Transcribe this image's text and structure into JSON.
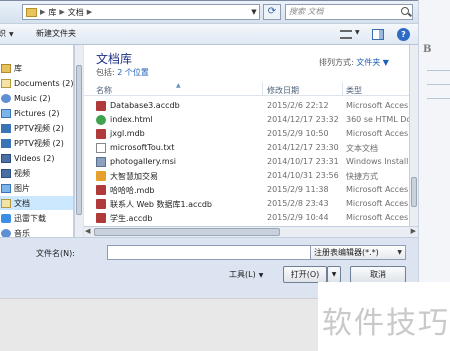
{
  "address_bar": {
    "segments": [
      "库",
      "文档"
    ]
  },
  "search": {
    "placeholder": "搜索 文档"
  },
  "toolbar": {
    "organize": "组织",
    "new_folder": "新建文件夹"
  },
  "nav": {
    "items": [
      {
        "label": "库",
        "icon": "library-icon"
      },
      {
        "label": "Documents (2)",
        "icon": "documents-icon"
      },
      {
        "label": "Music (2)",
        "icon": "music-icon"
      },
      {
        "label": "Pictures (2)",
        "icon": "pictures-icon"
      },
      {
        "label": "PPTV视频 (2)",
        "icon": "pptv-icon"
      },
      {
        "label": "PPTV视频 (2)",
        "icon": "pptv-icon"
      },
      {
        "label": "Videos (2)",
        "icon": "videos-icon"
      },
      {
        "label": "视频",
        "icon": "video-icon"
      },
      {
        "label": "图片",
        "icon": "picture-icon"
      },
      {
        "label": "文档",
        "icon": "document-icon"
      },
      {
        "label": "迅雷下载",
        "icon": "thunder-icon"
      },
      {
        "label": "音乐",
        "icon": "music-icon"
      }
    ]
  },
  "library": {
    "title": "文档库",
    "includes_label": "包括:",
    "includes_link": "2 个位置",
    "arrange_label": "排列方式:",
    "arrange_value": "文件夹"
  },
  "columns": {
    "name": "名称",
    "date": "修改日期",
    "type": "类型"
  },
  "files": [
    {
      "name": "Database3.accdb",
      "date": "2015/2/6 22:12",
      "type": "Microsoft Acces",
      "icon": "access-icon"
    },
    {
      "name": "index.html",
      "date": "2014/12/17 23:32",
      "type": "360 se HTML Do",
      "icon": "html-icon"
    },
    {
      "name": "jxgl.mdb",
      "date": "2015/2/9 10:50",
      "type": "Microsoft Acces",
      "icon": "access-icon"
    },
    {
      "name": "microsoftTou.txt",
      "date": "2014/12/17 23:30",
      "type": "文本文档",
      "icon": "text-icon"
    },
    {
      "name": "photogallery.msi",
      "date": "2014/10/17 23:31",
      "type": "Windows Install",
      "icon": "msi-icon"
    },
    {
      "name": "大智慧加交易",
      "date": "2014/10/31 23:56",
      "type": "快捷方式",
      "icon": "shortcut-icon"
    },
    {
      "name": "哈哈哈.mdb",
      "date": "2015/2/9 11:38",
      "type": "Microsoft Acces",
      "icon": "access-icon"
    },
    {
      "name": "联系人 Web 数据库1.accdb",
      "date": "2015/2/8 23:43",
      "type": "Microsoft Acces",
      "icon": "access-icon"
    },
    {
      "name": "学生.accdb",
      "date": "2015/2/9 10:44",
      "type": "Microsoft Acces",
      "icon": "access-icon"
    }
  ],
  "bottom": {
    "filename_label": "文件名(N):",
    "filter_value": "注册表编辑器(*.*)",
    "tools_label": "工具(L)",
    "open_label": "打开(O)",
    "cancel_label": "取消"
  },
  "watermark": "软件技巧",
  "colors": {
    "accent": "#1f5fb5",
    "selected": "#cce8ff",
    "title": "#1e3287"
  }
}
